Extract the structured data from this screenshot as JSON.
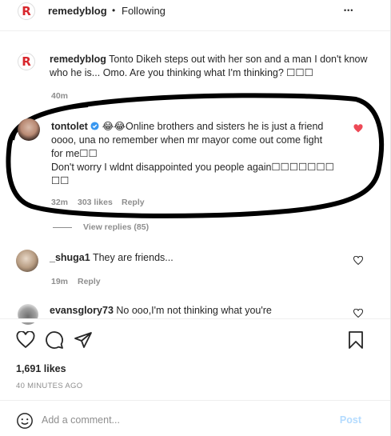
{
  "header": {
    "username": "remedyblog",
    "separator": "•",
    "follow_status": "Following",
    "more": "•••"
  },
  "caption": {
    "username": "remedyblog",
    "text": "Tonto Dikeh steps out with her son and a man I don't know who he is... Omo. Are you thinking what I'm thinking? ☐☐☐",
    "time": "40m"
  },
  "comments": [
    {
      "username": "tontolet",
      "line1": "😂😂Online brothers and sisters he is just a friend",
      "line2": "oooo, una no remember when mr mayor come out come fight",
      "line3": "for me☐☐",
      "line4": "Don't worry I wldnt disappointed you people again☐☐☐☐☐☐☐",
      "line5": "☐☐",
      "time": "32m",
      "likes": "303 likes",
      "reply": "Reply",
      "view_replies": "View replies (85)"
    },
    {
      "username": "_shuga1",
      "text": "They are friends...",
      "time": "19m",
      "reply": "Reply"
    },
    {
      "username": "evansglory73",
      "text": "No ooo,I'm not thinking what you're"
    }
  ],
  "actions": {
    "likes": "1,691 likes",
    "timestamp": "40 MINUTES AGO"
  },
  "comment_box": {
    "placeholder": "Add a comment...",
    "post_label": "Post"
  },
  "colors": {
    "like_red": "#ed4956",
    "verified_blue": "#3897f0",
    "post_disabled": "#b3dbff"
  }
}
